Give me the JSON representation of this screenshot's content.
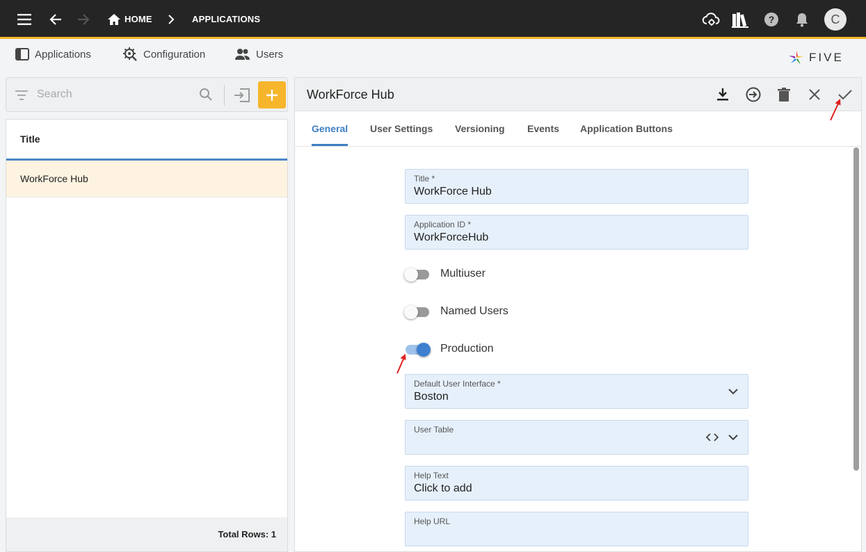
{
  "topbar": {
    "home_label": "HOME",
    "applications_label": "APPLICATIONS",
    "avatar_initial": "C"
  },
  "menubar": {
    "items": [
      {
        "label": "Applications",
        "icon": "panel-icon"
      },
      {
        "label": "Configuration",
        "icon": "gear-wrench-icon"
      },
      {
        "label": "Users",
        "icon": "users-icon"
      }
    ],
    "logo_text": "FIVE"
  },
  "search": {
    "placeholder": "Search"
  },
  "list": {
    "header": "Title",
    "rows": [
      "WorkForce Hub"
    ],
    "footer": "Total Rows: 1"
  },
  "form": {
    "title": "WorkForce Hub",
    "tabs": [
      "General",
      "User Settings",
      "Versioning",
      "Events",
      "Application Buttons"
    ],
    "active_tab": "General",
    "fields": {
      "title": {
        "label": "Title *",
        "value": "WorkForce Hub"
      },
      "app_id": {
        "label": "Application ID *",
        "value": "WorkForceHub"
      },
      "default_ui": {
        "label": "Default User Interface *",
        "value": "Boston"
      },
      "user_table": {
        "label": "User Table",
        "value": ""
      },
      "help_text": {
        "label": "Help Text",
        "value": "Click to add"
      },
      "help_url": {
        "label": "Help URL",
        "value": ""
      }
    },
    "toggles": {
      "multiuser": {
        "label": "Multiuser",
        "on": false
      },
      "named_users": {
        "label": "Named Users",
        "on": false
      },
      "production": {
        "label": "Production",
        "on": true
      }
    }
  },
  "colors": {
    "topbar_bg": "#252525",
    "accent_yellow": "#f6b52a",
    "accent_blue": "#3f7fc4",
    "field_bg": "#e6f0fb",
    "annotation_red": "#e02020"
  }
}
